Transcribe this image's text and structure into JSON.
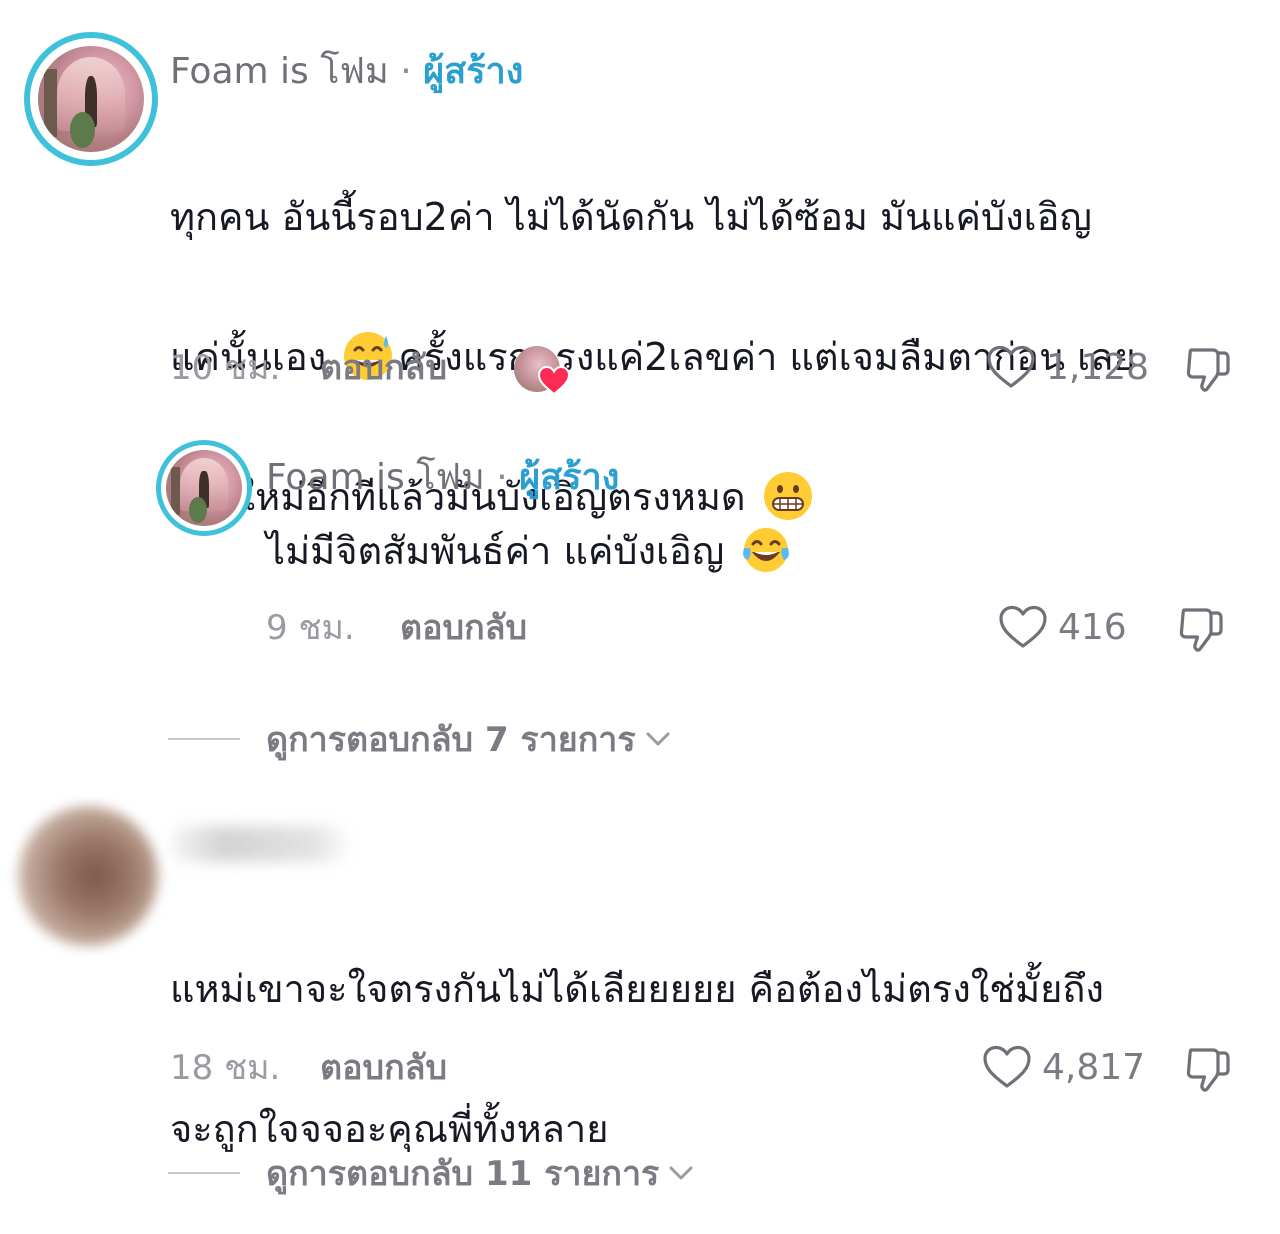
{
  "comments": [
    {
      "username": "Foam is โฟม",
      "separator": "·",
      "creator_label": "ผู้สร้าง",
      "text_lines": [
        "ทุกคน อันนี้รอบ2ค่า ไม่ได้นัดกัน ไม่ได้ซ้อม มันแค่บังเอิญ",
        "แค่นั้นเอง ",
        "ครั้งแรกตรงแค่2เลขค่า แต่เจมลืมตาก่อน เลย",
        "ถ่ายใหม่อีกทีแล้วมันบังเอิญตรงหมด "
      ],
      "emojis": [
        "sweat-smile-emoji",
        "grimace-emoji"
      ],
      "time": "10 ชม.",
      "reply_label": "ตอบกลับ",
      "likes": "1,128",
      "creator_liked": true,
      "replies": [
        {
          "username": "Foam is โฟม",
          "separator": "·",
          "creator_label": "ผู้สร้าง",
          "text": "ไม่มีจิตสัมพันธ์ค่า แค่บังเอิญ ",
          "emoji": "tears-of-joy-emoji",
          "time": "9 ชม.",
          "reply_label": "ตอบกลับ",
          "likes": "416"
        }
      ],
      "view_replies": "ดูการตอบกลับ 7 รายการ"
    },
    {
      "text_lines": [
        "แหม่เขาจะใจตรงกันไม่ได้เลียยยยย คือต้องไม่ตรงใช่มั้ยถึง",
        "จะถูกใจจจอะคุณพี่ทั้งหลาย"
      ],
      "time": "18 ชม.",
      "reply_label": "ตอบกลับ",
      "likes": "4,817",
      "view_replies": "ดูการตอบกลับ 11 รายการ"
    }
  ],
  "colors": {
    "text": "#161823",
    "muted": "#7b7c83",
    "creator": "#2a9fd0",
    "ring": "#3fc1dc",
    "heart_red": "#fe2c55"
  }
}
